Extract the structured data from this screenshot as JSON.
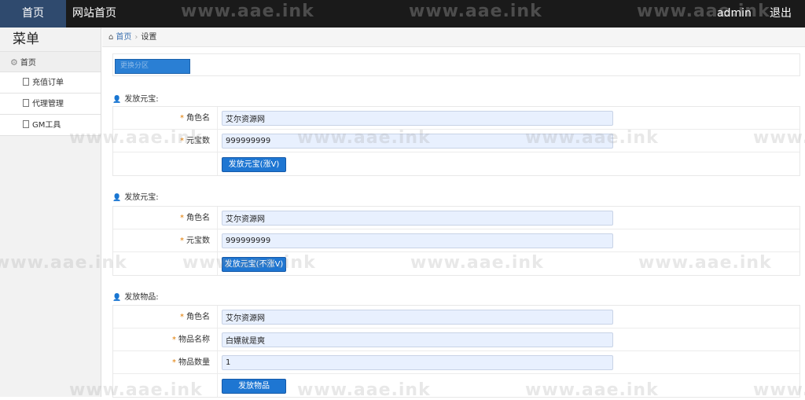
{
  "topbar": {
    "home": "首页",
    "site_home": "网站首页",
    "user": "admin",
    "logout": "退出"
  },
  "watermark": "www.aae.ink",
  "sidebar": {
    "title": "菜单",
    "home": "首页",
    "items": [
      {
        "label": "充值订单"
      },
      {
        "label": "代理管理"
      },
      {
        "label": "GM工具"
      }
    ]
  },
  "breadcrumb": {
    "home": "首页",
    "current": "设置"
  },
  "zone_button": "更换分区",
  "sections": [
    {
      "title": "发放元宝:",
      "fields": [
        {
          "label": "角色名",
          "value": "艾尔资源网"
        },
        {
          "label": "元宝数",
          "value": "999999999"
        }
      ],
      "button": "发放元宝(涨V)"
    },
    {
      "title": "发放元宝:",
      "fields": [
        {
          "label": "角色名",
          "value": "艾尔资源网"
        },
        {
          "label": "元宝数",
          "value": "999999999"
        }
      ],
      "button": "发放元宝(不涨V)"
    },
    {
      "title": "发放物品:",
      "fields": [
        {
          "label": "角色名",
          "value": "艾尔资源网"
        },
        {
          "label": "物品名称",
          "value": "白嫖就是爽"
        },
        {
          "label": "物品数量",
          "value": "1"
        }
      ],
      "button": "发放物品"
    }
  ],
  "required_mark": "*",
  "colors": {
    "topbar": "#1a1a1a",
    "active_tab": "#2f4a6e",
    "button": "#1e76d2",
    "input_bg": "#e8f0fe",
    "required": "#e07b00"
  }
}
